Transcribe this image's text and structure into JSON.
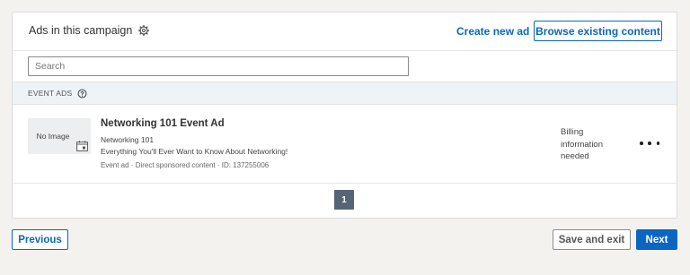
{
  "header": {
    "title": "Ads in this campaign",
    "create_link": "Create new ad",
    "browse_button": "Browse existing content"
  },
  "search": {
    "placeholder": "Search",
    "value": ""
  },
  "section": {
    "label": "EVENT ADS"
  },
  "ads": [
    {
      "thumbnail_text": "No Image",
      "title": "Networking 101 Event Ad",
      "subtitle": "Networking 101",
      "description": "Everything You'll Ever Want to Know About Networking!",
      "meta": "Event ad · Direct sponsored content  · ID: 137255006",
      "status": "Billing information needed"
    }
  ],
  "pagination": {
    "current_page": "1"
  },
  "footer": {
    "previous_label": "Previous",
    "save_exit_label": "Save and exit",
    "next_label": "Next"
  },
  "colors": {
    "accent": "#0a66c2",
    "page_button": "#566573",
    "section_bg": "#eef3f8"
  },
  "icons": {
    "settings": "gear-icon",
    "help": "help-icon",
    "calendar": "calendar-icon",
    "more": "more-icon"
  }
}
